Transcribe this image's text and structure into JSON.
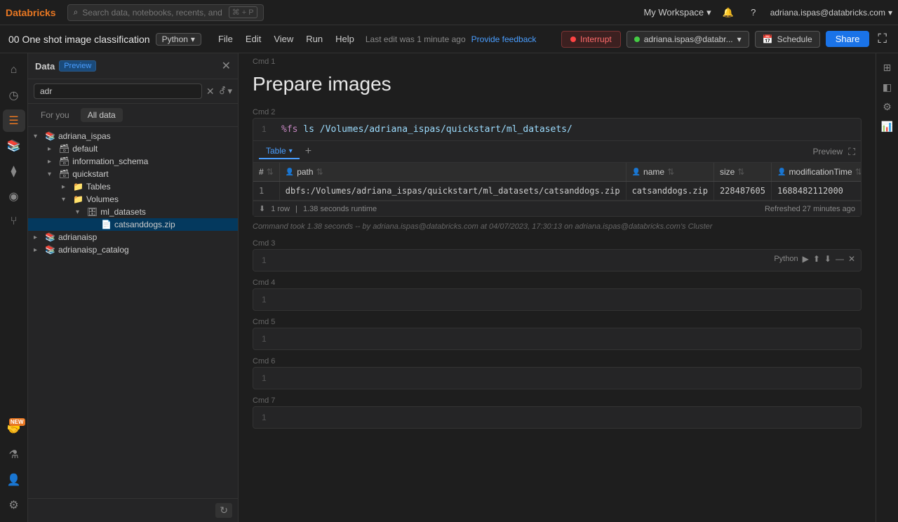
{
  "topbar": {
    "logo": "Databricks",
    "search_placeholder": "Search data, notebooks, recents, and more...",
    "shortcut": "⌘ + P",
    "workspace_label": "My Workspace",
    "user_email": "adriana.ispas@databricks.com"
  },
  "notebar": {
    "title": "00 One shot image classification",
    "lang": "Python",
    "menu_items": [
      "File",
      "Edit",
      "View",
      "Run",
      "Help"
    ],
    "last_edit": "Last edit was 1 minute ago",
    "feedback": "Provide feedback",
    "interrupt_label": "Interrupt",
    "user_dropdown": "adriana.ispas@databr...",
    "schedule_label": "Schedule",
    "share_label": "Share"
  },
  "data_panel": {
    "title": "Data",
    "preview_badge": "Preview",
    "search_value": "adr",
    "tab_for_you": "For you",
    "tab_all_data": "All data",
    "tree": [
      {
        "label": "adriana_ispas",
        "level": 0,
        "type": "catalog",
        "expanded": true,
        "children": [
          {
            "label": "default",
            "level": 1,
            "type": "schema",
            "expanded": false
          },
          {
            "label": "information_schema",
            "level": 1,
            "type": "schema",
            "expanded": false
          },
          {
            "label": "quickstart",
            "level": 1,
            "type": "schema",
            "expanded": true,
            "children": [
              {
                "label": "Tables",
                "level": 2,
                "type": "folder",
                "expanded": false
              },
              {
                "label": "Volumes",
                "level": 2,
                "type": "folder",
                "expanded": true,
                "children": [
                  {
                    "label": "ml_datasets",
                    "level": 3,
                    "type": "volume",
                    "expanded": true,
                    "children": [
                      {
                        "label": "catsanddogs.zip",
                        "level": 4,
                        "type": "file"
                      }
                    ]
                  }
                ]
              }
            ]
          }
        ]
      },
      {
        "label": "adrianaisp",
        "level": 0,
        "type": "catalog",
        "expanded": false
      },
      {
        "label": "adrianaisp_catalog",
        "level": 0,
        "type": "catalog",
        "expanded": false
      }
    ]
  },
  "notebook": {
    "cells": [
      {
        "cmd": "Cmd 1",
        "title": "Prepare images",
        "type": "markdown"
      },
      {
        "cmd": "Cmd 2",
        "lines": [
          {
            "num": 1,
            "code": "%fs ls /Volumes/adriana_ispas/quickstart/ml_datasets/"
          }
        ],
        "output": {
          "tab_label": "Table",
          "preview_label": "Preview",
          "columns": [
            "#",
            "path",
            "name",
            "size",
            "modificationTime"
          ],
          "col_icons": [
            "",
            "person",
            "person",
            "",
            "person"
          ],
          "rows": [
            {
              "num": 1,
              "path": "dbfs:/Volumes/adriana_ispas/quickstart/ml_datasets/catsanddogs.zip",
              "name": "catsanddogs.zip",
              "size": "228487605",
              "modificationTime": "1688482112000"
            }
          ],
          "row_count": "1 row",
          "runtime": "1.38 seconds runtime",
          "refreshed": "Refreshed 27 minutes ago"
        },
        "meta": "Command took 1.38 seconds -- by adriana.ispas@databricks.com at 04/07/2023, 17:30:13 on adriana.ispas@databricks.com's Cluster"
      },
      {
        "cmd": "Cmd 3",
        "lang": "Python",
        "lines": [
          {
            "num": 1,
            "code": ""
          }
        ]
      },
      {
        "cmd": "Cmd 4",
        "lines": [
          {
            "num": 1,
            "code": ""
          }
        ]
      },
      {
        "cmd": "Cmd 5",
        "lines": [
          {
            "num": 1,
            "code": ""
          }
        ]
      },
      {
        "cmd": "Cmd 6",
        "lines": [
          {
            "num": 1,
            "code": ""
          }
        ]
      },
      {
        "cmd": "Cmd 7",
        "lines": [
          {
            "num": 1,
            "code": ""
          }
        ]
      }
    ]
  },
  "icons": {
    "logo": "◈",
    "search": "⌕",
    "home": "⌂",
    "recent": "◷",
    "data": "☰",
    "workflow": "⧫",
    "compute": "◉",
    "git": "⑂",
    "experiment": "⚗",
    "people": "👤",
    "partner": "🤝",
    "bell": "🔔",
    "help": "?",
    "gear": "⚙",
    "chevron_down": "▾",
    "chevron_right": "▸",
    "chevron_left": "◂",
    "close": "✕",
    "plus": "+",
    "filter": "⚦",
    "catalog": "📚",
    "schema": "🗃",
    "folder": "📁",
    "volume": "🗄",
    "file": "📄",
    "table_icon": "⊞",
    "person_col": "👤",
    "sort": "⇅",
    "download": "⬇",
    "expand": "⛶",
    "play": "▶",
    "run_above": "⬆",
    "run_below": "⬇",
    "close_cell": "✕",
    "calendar": "📅"
  }
}
